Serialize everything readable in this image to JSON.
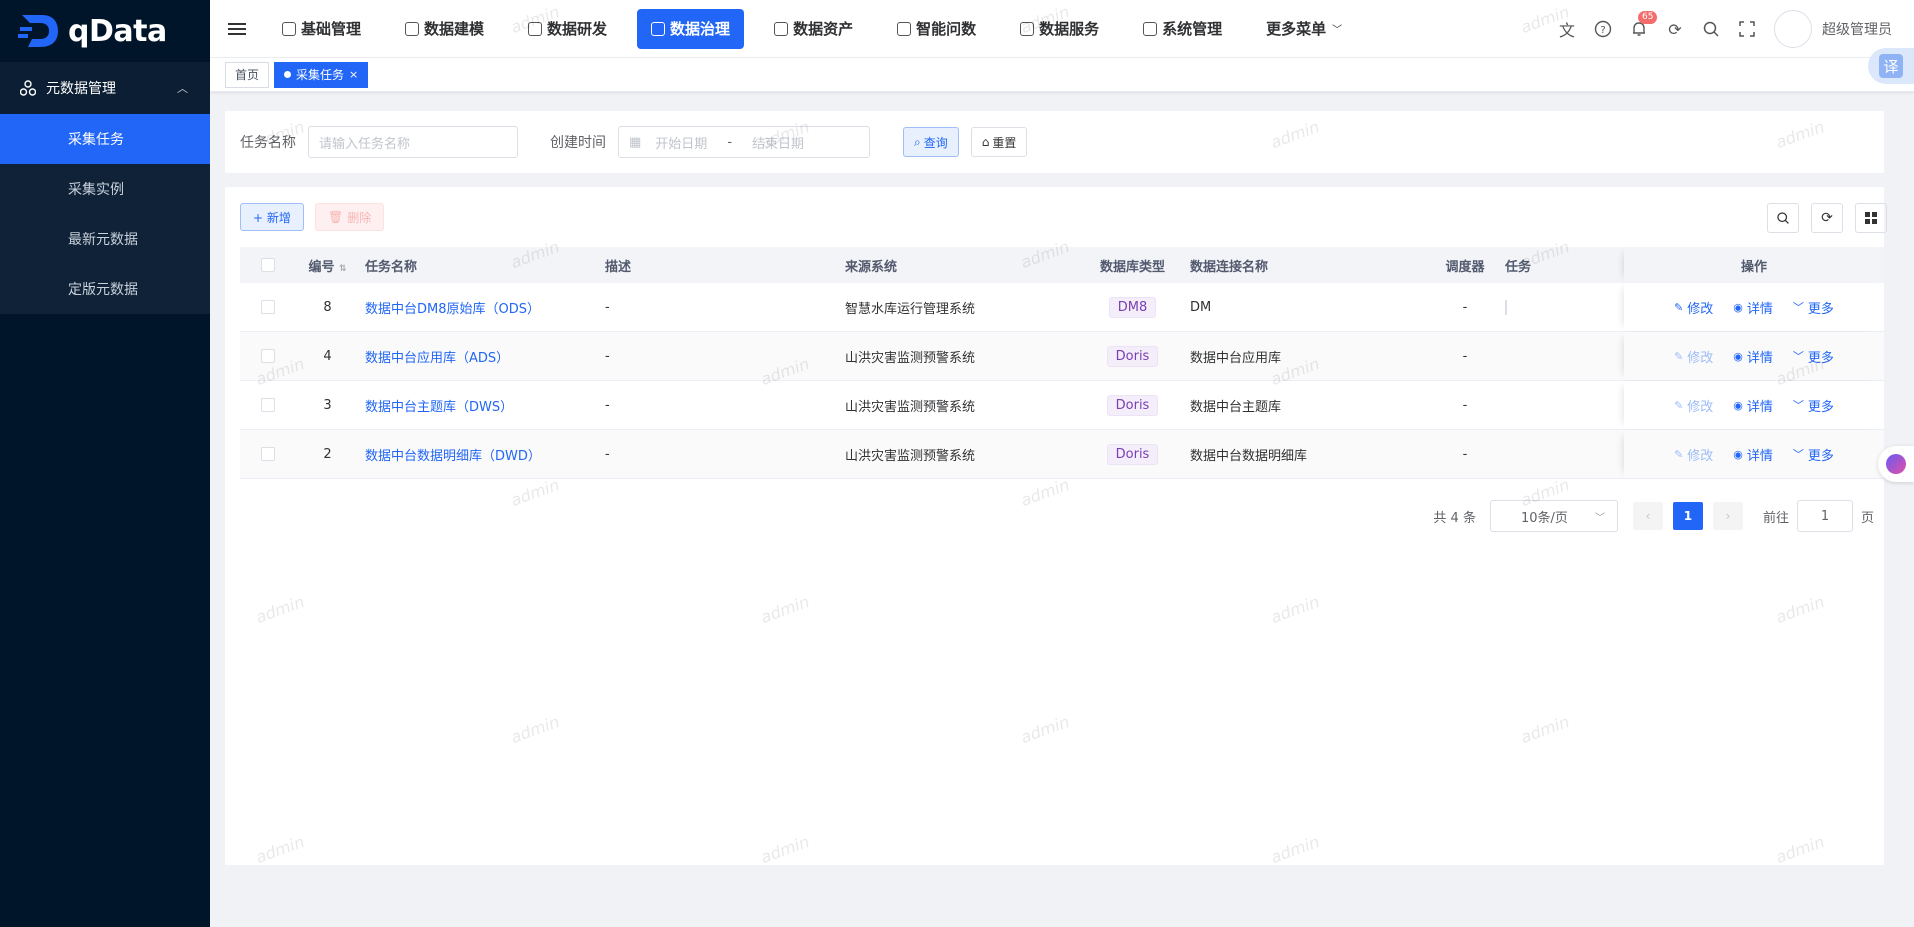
{
  "app": {
    "logo_text": "qData",
    "user": "超级管理员",
    "notification_count": "65",
    "translate_label": "译"
  },
  "nav": [
    {
      "label": "基础管理"
    },
    {
      "label": "数据建模"
    },
    {
      "label": "数据研发"
    },
    {
      "label": "数据治理",
      "active": true
    },
    {
      "label": "数据资产"
    },
    {
      "label": "智能问数"
    },
    {
      "label": "数据服务"
    },
    {
      "label": "系统管理"
    },
    {
      "label": "更多菜单"
    }
  ],
  "sidebar": {
    "group": "元数据管理",
    "items": [
      {
        "label": "采集任务",
        "active": true
      },
      {
        "label": "采集实例"
      },
      {
        "label": "最新元数据"
      },
      {
        "label": "定版元数据"
      }
    ]
  },
  "tags": {
    "home": "首页",
    "current": "采集任务"
  },
  "search": {
    "name_label": "任务名称",
    "name_placeholder": "请输入任务名称",
    "time_label": "创建时间",
    "start_placeholder": "开始日期",
    "range_sep": "-",
    "end_placeholder": "结束日期",
    "query_label": "查询",
    "reset_label": "重置"
  },
  "toolbar": {
    "add_label": "+ 新增",
    "delete_label": "删除"
  },
  "table": {
    "headers": [
      "编号",
      "任务名称",
      "描述",
      "来源系统",
      "数据库类型",
      "数据连接名称",
      "调度器",
      "任务",
      "操作"
    ],
    "rows": [
      {
        "id": "8",
        "name": "数据中台DM8原始库（ODS）",
        "desc": "-",
        "source": "智慧水库运行管理系统",
        "db_type": "DM8",
        "conn": "DM",
        "sched": "-",
        "enabled": false,
        "edit_enabled": true
      },
      {
        "id": "4",
        "name": "数据中台应用库（ADS）",
        "desc": "-",
        "source": "山洪灾害监测预警系统",
        "db_type": "Doris",
        "conn": "数据中台应用库",
        "sched": "-",
        "enabled": true,
        "edit_enabled": false
      },
      {
        "id": "3",
        "name": "数据中台主题库（DWS）",
        "desc": "-",
        "source": "山洪灾害监测预警系统",
        "db_type": "Doris",
        "conn": "数据中台主题库",
        "sched": "-",
        "enabled": true,
        "edit_enabled": false
      },
      {
        "id": "2",
        "name": "数据中台数据明细库（DWD）",
        "desc": "-",
        "source": "山洪灾害监测预警系统",
        "db_type": "Doris",
        "conn": "数据中台数据明细库",
        "sched": "-",
        "enabled": true,
        "edit_enabled": false
      }
    ],
    "ops": {
      "edit": "修改",
      "detail": "详情",
      "more": "更多"
    }
  },
  "pager": {
    "total_text": "共 4 条",
    "page_size": "10条/页",
    "current": "1",
    "goto_label": "前往",
    "goto_value": "1",
    "page_suffix": "页"
  },
  "watermark": "admin",
  "colors": {
    "primary": "#2166f6",
    "sidebar_bg": "#001529"
  }
}
